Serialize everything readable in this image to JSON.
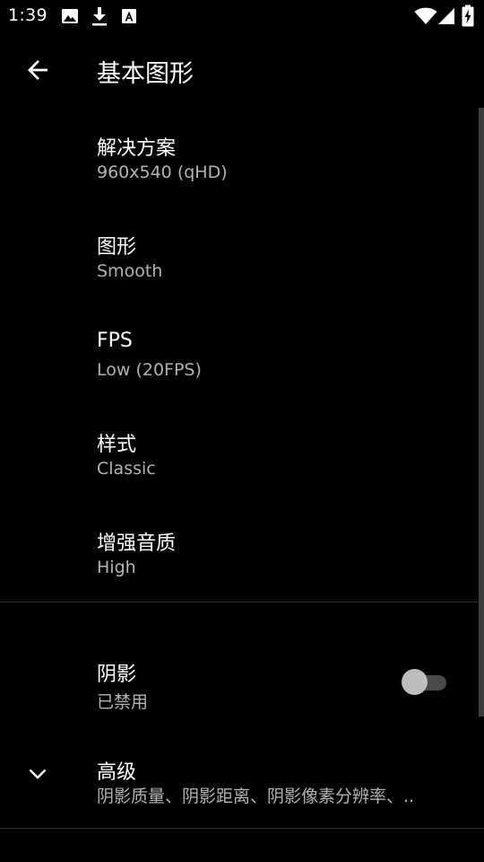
{
  "status_bar": {
    "time": "1:39",
    "icons": [
      "image-icon",
      "download-icon",
      "text-a-icon",
      "wifi-icon",
      "signal-icon",
      "battery-charging-icon"
    ]
  },
  "app_bar": {
    "title": "基本图形",
    "back_icon": "arrow-back-icon"
  },
  "preferences": [
    {
      "title": "解决方案",
      "summary": "960x540 (qHD)"
    },
    {
      "title": "图形",
      "summary": "Smooth"
    },
    {
      "title": "FPS",
      "summary": "Low (20FPS)"
    },
    {
      "title": "样式",
      "summary": "Classic"
    },
    {
      "title": "增强音质",
      "summary": "High"
    }
  ],
  "shadow": {
    "title": "阴影",
    "summary": "已禁用",
    "enabled": false
  },
  "advanced": {
    "title": "高级",
    "summary": "阴影质量、阴影距离、阴影像素分辨率、..",
    "icon": "chevron-down-icon"
  }
}
